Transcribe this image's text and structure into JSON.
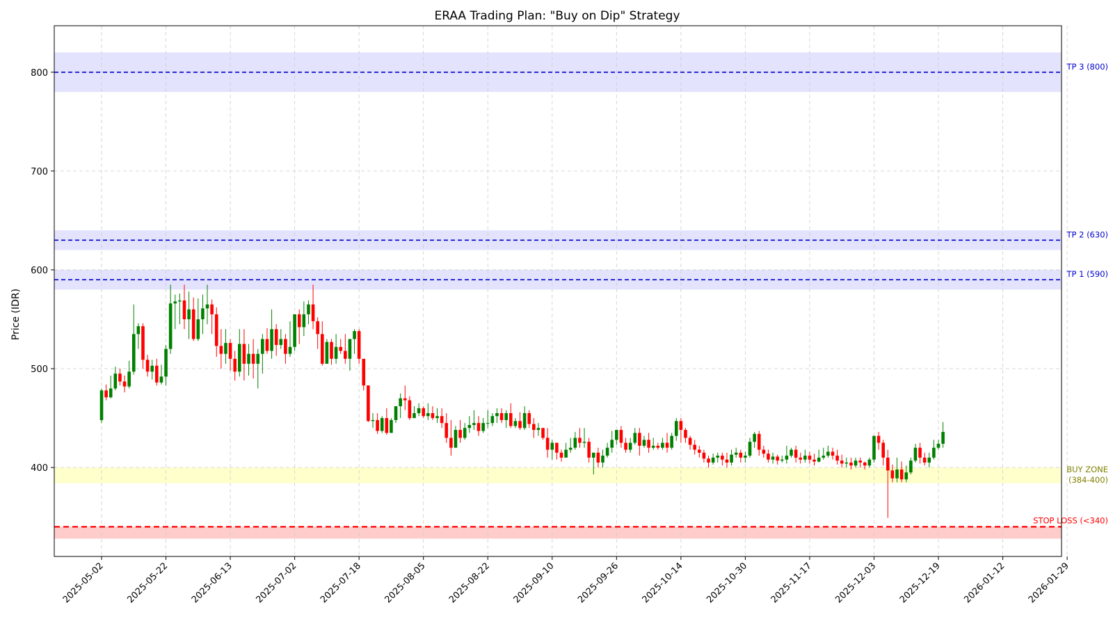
{
  "chart_data": {
    "type": "candlestick",
    "title": "ERAA Trading Plan: \"Buy on Dip\" Strategy",
    "xlabel": "",
    "ylabel": "Price (IDR)",
    "ylim": [
      310,
      847
    ],
    "grid": true,
    "x_tick_labels": [
      "2025-05-02",
      "2025-05-22",
      "2025-06-13",
      "2025-07-02",
      "2025-07-18",
      "2025-08-05",
      "2025-08-22",
      "2025-09-10",
      "2025-09-26",
      "2025-10-14",
      "2025-10-30",
      "2025-11-17",
      "2025-12-03",
      "2025-12-19",
      "2026-01-12",
      "2026-01-29"
    ],
    "y_ticks": [
      400,
      500,
      600,
      700,
      800
    ],
    "colors": {
      "up": "#008000",
      "down": "#ff0000",
      "target": "#0000cc",
      "buy_zone_text": "#808000",
      "stop_loss": "#ff0000"
    },
    "levels": [
      {
        "name": "TP 3 (800)",
        "value": 800,
        "band": [
          780,
          820
        ],
        "color": "#0000cc",
        "band_color": "#e3e3fd"
      },
      {
        "name": "TP 2 (630)",
        "value": 630,
        "band": [
          620,
          640
        ],
        "color": "#0000cc",
        "band_color": "#e3e3fd"
      },
      {
        "name": "TP 1 (590)",
        "value": 590,
        "band": [
          580,
          600
        ],
        "color": "#0000cc",
        "band_color": "#e3e3fd"
      },
      {
        "name": "STOP LOSS (<340)",
        "value": 340,
        "band": [
          328,
          340
        ],
        "color": "#ff0000",
        "band_color": "#ffcccc"
      }
    ],
    "buy_zone": {
      "label_line1": "BUY ZONE",
      "label_line2": "(384-400)",
      "range": [
        384,
        400
      ],
      "color": "#808000",
      "band_color": "#ffffcc"
    },
    "candles": [
      [
        448,
        478,
        445,
        480
      ],
      [
        478,
        471,
        468,
        484
      ],
      [
        471,
        480,
        470,
        493
      ],
      [
        480,
        495,
        478,
        502
      ],
      [
        495,
        487,
        483,
        500
      ],
      [
        487,
        482,
        476,
        493
      ],
      [
        482,
        497,
        480,
        508
      ],
      [
        497,
        535,
        494,
        565
      ],
      [
        535,
        543,
        520,
        546
      ],
      [
        543,
        509,
        500,
        546
      ],
      [
        509,
        497,
        492,
        514
      ],
      [
        497,
        503,
        489,
        509
      ],
      [
        503,
        486,
        483,
        510
      ],
      [
        486,
        492,
        484,
        504
      ],
      [
        492,
        520,
        483,
        524
      ],
      [
        520,
        566,
        515,
        585
      ],
      [
        566,
        568,
        540,
        575
      ],
      [
        568,
        569,
        545,
        576
      ],
      [
        569,
        550,
        540,
        585
      ],
      [
        550,
        560,
        530,
        578
      ],
      [
        560,
        530,
        528,
        572
      ],
      [
        530,
        550,
        528,
        571
      ],
      [
        550,
        561,
        535,
        575
      ],
      [
        561,
        565,
        545,
        585
      ],
      [
        565,
        555,
        535,
        570
      ],
      [
        555,
        523,
        512,
        562
      ],
      [
        523,
        515,
        500,
        540
      ],
      [
        515,
        526,
        505,
        540
      ],
      [
        526,
        510,
        498,
        530
      ],
      [
        510,
        497,
        488,
        518
      ],
      [
        497,
        525,
        492,
        540
      ],
      [
        525,
        505,
        488,
        540
      ],
      [
        505,
        515,
        493,
        525
      ],
      [
        515,
        505,
        490,
        530
      ],
      [
        505,
        515,
        480,
        520
      ],
      [
        515,
        530,
        495,
        535
      ],
      [
        530,
        518,
        515,
        541
      ],
      [
        518,
        540,
        510,
        560
      ],
      [
        540,
        524,
        513,
        545
      ],
      [
        524,
        530,
        520,
        540
      ],
      [
        530,
        515,
        505,
        535
      ],
      [
        515,
        522,
        512,
        548
      ],
      [
        522,
        555,
        518,
        555
      ],
      [
        555,
        542,
        525,
        560
      ],
      [
        542,
        555,
        533,
        568
      ],
      [
        555,
        565,
        545,
        569
      ],
      [
        565,
        548,
        540,
        585
      ],
      [
        548,
        535,
        520,
        552
      ],
      [
        535,
        505,
        503,
        548
      ],
      [
        505,
        527,
        505,
        530
      ],
      [
        527,
        510,
        504,
        530
      ],
      [
        510,
        522,
        505,
        535
      ],
      [
        522,
        518,
        515,
        530
      ],
      [
        518,
        510,
        505,
        535
      ],
      [
        510,
        530,
        498,
        530
      ],
      [
        530,
        538,
        515,
        540
      ],
      [
        538,
        510,
        505,
        540
      ],
      [
        510,
        483,
        478,
        510
      ],
      [
        483,
        447,
        446,
        483
      ],
      [
        447,
        448,
        440,
        455
      ],
      [
        448,
        437,
        434,
        455
      ],
      [
        437,
        450,
        435,
        452
      ],
      [
        450,
        435,
        433,
        460
      ],
      [
        435,
        448,
        435,
        450
      ],
      [
        448,
        462,
        445,
        462
      ],
      [
        462,
        470,
        450,
        475
      ],
      [
        470,
        468,
        458,
        483
      ],
      [
        468,
        450,
        448,
        472
      ],
      [
        450,
        455,
        450,
        462
      ],
      [
        455,
        460,
        452,
        465
      ],
      [
        460,
        452,
        450,
        462
      ],
      [
        452,
        455,
        448,
        465
      ],
      [
        455,
        450,
        448,
        462
      ],
      [
        450,
        452,
        445,
        460
      ],
      [
        452,
        445,
        440,
        460
      ],
      [
        445,
        430,
        425,
        455
      ],
      [
        430,
        420,
        412,
        448
      ],
      [
        420,
        438,
        420,
        442
      ],
      [
        438,
        430,
        425,
        448
      ],
      [
        430,
        440,
        428,
        445
      ],
      [
        440,
        443,
        435,
        452
      ],
      [
        443,
        445,
        438,
        458
      ],
      [
        445,
        437,
        432,
        452
      ],
      [
        437,
        445,
        435,
        450
      ],
      [
        445,
        445,
        440,
        458
      ],
      [
        445,
        452,
        442,
        455
      ],
      [
        452,
        455,
        445,
        460
      ],
      [
        455,
        448,
        445,
        460
      ],
      [
        448,
        455,
        440,
        458
      ],
      [
        455,
        442,
        440,
        465
      ],
      [
        442,
        447,
        440,
        450
      ],
      [
        447,
        440,
        438,
        456
      ],
      [
        440,
        455,
        438,
        462
      ],
      [
        455,
        444,
        440,
        458
      ],
      [
        444,
        438,
        430,
        450
      ],
      [
        438,
        440,
        432,
        445
      ],
      [
        440,
        430,
        428,
        440
      ],
      [
        430,
        418,
        410,
        440
      ],
      [
        418,
        425,
        408,
        428
      ],
      [
        425,
        415,
        408,
        418
      ],
      [
        415,
        410,
        406,
        418
      ],
      [
        410,
        418,
        410,
        425
      ],
      [
        418,
        420,
        415,
        430
      ],
      [
        420,
        430,
        418,
        436
      ],
      [
        430,
        425,
        420,
        440
      ],
      [
        425,
        426,
        420,
        440
      ],
      [
        426,
        410,
        405,
        430
      ],
      [
        410,
        415,
        393,
        415
      ],
      [
        415,
        405,
        400,
        420
      ],
      [
        405,
        412,
        400,
        418
      ],
      [
        412,
        420,
        410,
        425
      ],
      [
        420,
        428,
        415,
        437
      ],
      [
        428,
        438,
        423,
        438
      ],
      [
        438,
        425,
        420,
        442
      ],
      [
        425,
        418,
        415,
        430
      ],
      [
        418,
        425,
        415,
        430
      ],
      [
        425,
        435,
        423,
        440
      ],
      [
        435,
        422,
        412,
        440
      ],
      [
        422,
        428,
        420,
        432
      ],
      [
        428,
        420,
        415,
        435
      ],
      [
        420,
        422,
        418,
        430
      ],
      [
        422,
        420,
        418,
        425
      ],
      [
        420,
        425,
        418,
        430
      ],
      [
        425,
        420,
        415,
        435
      ],
      [
        420,
        432,
        418,
        435
      ],
      [
        432,
        447,
        427,
        450
      ],
      [
        447,
        438,
        425,
        450
      ],
      [
        438,
        430,
        425,
        440
      ],
      [
        430,
        423,
        418,
        432
      ],
      [
        423,
        418,
        413,
        428
      ],
      [
        418,
        415,
        410,
        422
      ],
      [
        415,
        409,
        405,
        418
      ],
      [
        409,
        405,
        400,
        412
      ],
      [
        405,
        410,
        403,
        414
      ],
      [
        410,
        412,
        405,
        415
      ],
      [
        412,
        408,
        402,
        415
      ],
      [
        408,
        405,
        400,
        415
      ],
      [
        405,
        413,
        402,
        418
      ],
      [
        413,
        415,
        410,
        420
      ],
      [
        415,
        410,
        405,
        418
      ],
      [
        410,
        412,
        405,
        416
      ],
      [
        412,
        426,
        410,
        430
      ],
      [
        426,
        434,
        420,
        436
      ],
      [
        434,
        418,
        412,
        437
      ],
      [
        418,
        414,
        410,
        422
      ],
      [
        414,
        408,
        405,
        418
      ],
      [
        408,
        411,
        404,
        415
      ],
      [
        411,
        407,
        403,
        413
      ],
      [
        407,
        408,
        405,
        412
      ],
      [
        408,
        412,
        404,
        422
      ],
      [
        412,
        418,
        410,
        420
      ],
      [
        418,
        410,
        405,
        422
      ],
      [
        410,
        408,
        404,
        415
      ],
      [
        408,
        412,
        405,
        418
      ],
      [
        412,
        408,
        404,
        416
      ],
      [
        408,
        406,
        402,
        414
      ],
      [
        406,
        410,
        405,
        418
      ],
      [
        410,
        412,
        408,
        420
      ],
      [
        412,
        416,
        410,
        422
      ],
      [
        416,
        412,
        408,
        420
      ],
      [
        412,
        407,
        403,
        418
      ],
      [
        407,
        404,
        400,
        413
      ],
      [
        404,
        405,
        400,
        410
      ],
      [
        405,
        402,
        398,
        410
      ],
      [
        402,
        407,
        400,
        410
      ],
      [
        407,
        405,
        400,
        410
      ],
      [
        405,
        402,
        398,
        406
      ],
      [
        402,
        408,
        400,
        410
      ],
      [
        408,
        432,
        405,
        432
      ],
      [
        432,
        425,
        418,
        436
      ],
      [
        425,
        410,
        402,
        428
      ],
      [
        410,
        397,
        349,
        418
      ],
      [
        397,
        389,
        385,
        403
      ],
      [
        389,
        398,
        385,
        410
      ],
      [
        398,
        388,
        385,
        406
      ],
      [
        388,
        395,
        385,
        402
      ],
      [
        395,
        407,
        393,
        410
      ],
      [
        407,
        420,
        405,
        424
      ],
      [
        420,
        410,
        404,
        425
      ],
      [
        410,
        405,
        402,
        415
      ],
      [
        405,
        410,
        400,
        415
      ],
      [
        410,
        420,
        408,
        428
      ],
      [
        420,
        424,
        418,
        428
      ],
      [
        424,
        436,
        420,
        446
      ]
    ]
  }
}
